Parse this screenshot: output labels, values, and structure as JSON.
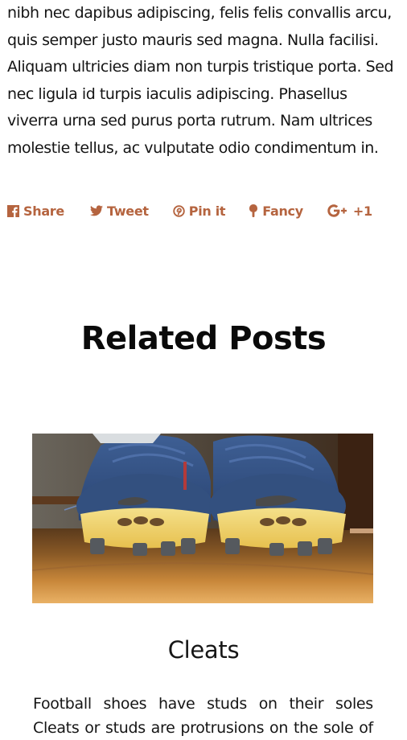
{
  "article": {
    "lines": [
      "nibh nec dapibus adipiscing, felis felis convallis arcu,",
      "quis semper justo mauris sed magna. Nulla facilisi.",
      "Aliquam ultricies diam non turpis tristique porta. Sed",
      "nec ligula id turpis iaculis adipiscing. Phasellus",
      "viverra urna sed purus porta rutrum. Nam ultrices",
      "molestie tellus, ac vulputate odio condimentum in."
    ]
  },
  "share": {
    "color": "#b5643f",
    "items": [
      {
        "label": "Share",
        "icon": "facebook-icon"
      },
      {
        "label": "Tweet",
        "icon": "twitter-icon"
      },
      {
        "label": "Pin it",
        "icon": "pinterest-icon"
      },
      {
        "label": "Fancy",
        "icon": "fancy-icon"
      },
      {
        "label": "+1",
        "icon": "google-plus-icon"
      }
    ]
  },
  "related": {
    "title": "Related Posts",
    "posts": [
      {
        "title": "Cleats",
        "image_alt": "Pair of worn blue football cleats with yellow soles on a wooden floor",
        "excerpt_lines": [
          "Football shoes have studs on their soles",
          "Cleats or studs are protrusions on the sole of"
        ]
      }
    ]
  }
}
